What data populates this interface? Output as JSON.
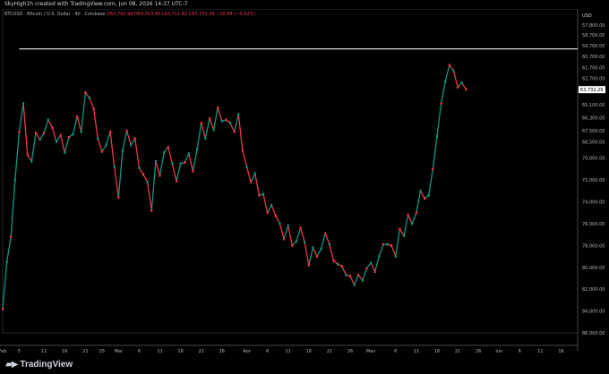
{
  "header": {
    "creator": "SkyHigh1h created with TradingView.com, Jun 08, 2026 14:37 UTC-7",
    "legend_symbol": "BTCUSD · Bitcoin / U.S. Dollar · 4h · Coinbase",
    "legend_ohlc": "O63,742.94 H64,013.40 L63,711.82 C63,732.29 −10.64 (−0.02%)"
  },
  "brand": {
    "name": "TradingView",
    "icon": "tradingview-logo-icon"
  },
  "colors": {
    "up": "#089981",
    "down": "#f23645",
    "line": "#d9d9d9",
    "price_tag": "#ffffff"
  },
  "chart_data": {
    "type": "line",
    "title": "",
    "symbol": "BTCUSD",
    "price_axis": {
      "currency_label": "USD",
      "inverted": true,
      "range": [
        57000,
        86000
      ],
      "ticks": [
        "57,800.00",
        "58,700.00",
        "59,700.00",
        "60,700.00",
        "61,700.00",
        "62,700.00",
        "63,900.00",
        "65,100.00",
        "66,300.00",
        "67,500.00",
        "68,500.00",
        "70,000.00",
        "72,000.00",
        "74,000.00",
        "76,000.00",
        "78,000.00",
        "80,000.00",
        "82,000.00",
        "84,000.00",
        "86,000.00"
      ],
      "tick_values": [
        57800,
        58700,
        59700,
        60700,
        61700,
        62700,
        63900,
        65100,
        66300,
        67500,
        68500,
        70000,
        72000,
        74000,
        76000,
        78000,
        80000,
        82000,
        84000,
        86000
      ]
    },
    "time_axis": {
      "ticks": [
        "Feb",
        "5",
        "11",
        "16",
        "21",
        "25",
        "Mar",
        "6",
        "11",
        "16",
        "21",
        "26",
        "Apr",
        "6",
        "11",
        "16",
        "21",
        "26",
        "May",
        "6",
        "11",
        "16",
        "21",
        "26",
        "Jun",
        "6",
        "11",
        "16"
      ],
      "day_index": [
        0,
        4,
        10,
        15,
        20,
        24,
        28,
        33,
        38,
        43,
        48,
        53,
        59,
        64,
        69,
        74,
        79,
        84,
        89,
        95,
        100,
        105,
        110,
        115,
        120,
        125,
        130,
        135
      ],
      "day_range": [
        0,
        139
      ]
    },
    "horizontal_line": {
      "value": 60000
    },
    "current_price": {
      "value": 63732.29,
      "label": "63,732.29"
    },
    "series": [
      {
        "day": [
          0,
          1,
          2,
          3,
          4,
          5,
          6,
          7,
          8,
          9,
          10,
          11,
          12,
          13,
          14,
          15,
          16,
          17,
          18,
          19,
          20,
          21,
          22,
          23,
          24,
          25,
          26,
          27,
          28,
          29,
          30,
          31,
          32,
          33,
          34,
          35,
          36,
          37,
          38,
          39,
          40,
          41,
          42,
          43,
          44,
          45,
          46,
          47,
          48,
          49,
          50,
          51,
          52,
          53,
          54,
          55,
          56,
          57,
          58,
          59,
          60,
          61,
          62,
          63,
          64,
          65,
          66,
          67,
          68,
          69,
          70,
          71,
          72,
          73,
          74,
          75,
          76,
          77,
          78,
          79,
          80,
          81,
          82,
          83,
          84,
          85,
          86,
          87,
          88,
          89,
          90,
          91,
          92,
          93,
          94,
          95,
          96,
          97,
          98,
          99,
          100,
          101,
          102,
          103,
          104,
          105,
          106,
          107,
          108,
          109,
          110,
          111,
          112,
          113,
          114,
          115,
          116,
          117,
          118,
          119,
          120,
          121,
          122,
          123,
          124,
          125,
          126,
          127
        ],
        "price": [
          83800,
          79500,
          77200,
          72000,
          67600,
          65000,
          69700,
          70300,
          67700,
          68300,
          67700,
          66500,
          67200,
          68500,
          67900,
          69500,
          68100,
          67800,
          66200,
          67600,
          64000,
          64500,
          65500,
          68200,
          69400,
          68800,
          67600,
          70800,
          73600,
          69300,
          67500,
          68800,
          68200,
          70900,
          71500,
          72200,
          74800,
          70300,
          71600,
          69500,
          69000,
          70500,
          72100,
          70500,
          70400,
          69600,
          71200,
          69200,
          66800,
          68200,
          66400,
          67400,
          65400,
          66600,
          66500,
          66800,
          67600,
          66000,
          69300,
          70800,
          72200,
          71400,
          73400,
          73300,
          75000,
          74300,
          75300,
          76000,
          77400,
          76200,
          78000,
          77600,
          76400,
          77700,
          79800,
          78200,
          79000,
          78300,
          76900,
          77900,
          79400,
          79700,
          79900,
          80700,
          80800,
          81600,
          80700,
          81200,
          80100,
          79600,
          80400,
          79000,
          77900,
          77900,
          78000,
          79000,
          76500,
          77100,
          75200,
          76000,
          75000,
          73000,
          73700,
          73400,
          71000,
          68000,
          65000,
          63000,
          61500,
          62000,
          63500,
          63100,
          63700
        ]
      }
    ]
  }
}
